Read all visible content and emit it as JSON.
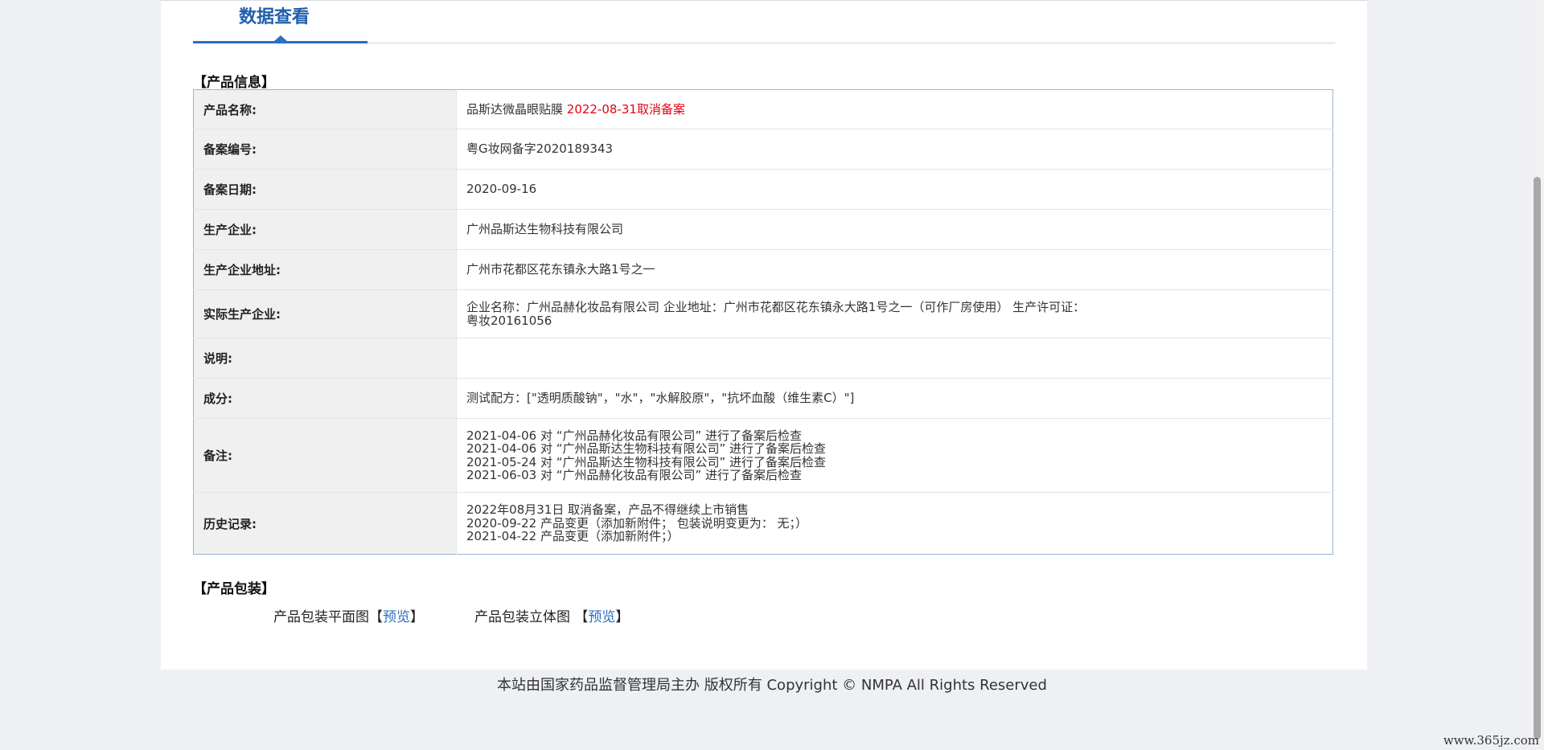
{
  "tab": {
    "title": "数据查看"
  },
  "product_info": {
    "section_title": "【产品信息】",
    "rows": [
      {
        "label": "产品名称:",
        "lines": [
          "品斯达微晶眼贴膜 "
        ],
        "highlight": "2022-08-31取消备案"
      },
      {
        "label": "备案编号:",
        "lines": [
          "粤G妆网备字2020189343"
        ]
      },
      {
        "label": "备案日期:",
        "lines": [
          "2020-09-16"
        ]
      },
      {
        "label": "生产企业:",
        "lines": [
          "广州品斯达生物科技有限公司"
        ]
      },
      {
        "label": "生产企业地址:",
        "lines": [
          "广州市花都区花东镇永大路1号之一"
        ]
      },
      {
        "label": "实际生产企业:",
        "lines": [
          "企业名称：广州品赫化妆品有限公司 企业地址：广州市花都区花东镇永大路1号之一（可作厂房使用） 生产许可证：",
          "粤妆20161056"
        ]
      },
      {
        "label": "说明:",
        "lines": []
      },
      {
        "label": "成分:",
        "lines": [
          "测试配方：[\"透明质酸钠\"，\"水\"，\"水解胶原\"，\"抗坏血酸（维生素C）\"]"
        ]
      },
      {
        "label": "备注:",
        "lines": [
          "2021-04-06 对 “广州品赫化妆品有限公司” 进行了备案后检查",
          "2021-04-06 对 “广州品斯达生物科技有限公司” 进行了备案后检查",
          "2021-05-24 对 “广州品斯达生物科技有限公司” 进行了备案后检查",
          "2021-06-03 对 “广州品赫化妆品有限公司” 进行了备案后检查"
        ]
      },
      {
        "label": "历史记录:",
        "lines": [
          "2022年08月31日 取消备案，产品不得继续上市销售",
          "2020-09-22 产品变更（添加新附件；  包装说明变更为：  无；）",
          "2021-04-22 产品变更（添加新附件；）"
        ]
      }
    ]
  },
  "packaging": {
    "section_title": "【产品包装】",
    "flat_label": "产品包装平面图",
    "solid_label": "产品包装立体图 ",
    "bracket_open": "【",
    "bracket_close": "】",
    "preview_link": "预览"
  },
  "footer": {
    "text": "本站由国家药品监督管理局主办 版权所有 Copyright © NMPA All Rights Reserved"
  },
  "watermark": {
    "text": "www.365jz.com"
  },
  "colors": {
    "accent": "#2b6fbf",
    "warning": "#e60012",
    "table_border": "#9db3d6"
  }
}
